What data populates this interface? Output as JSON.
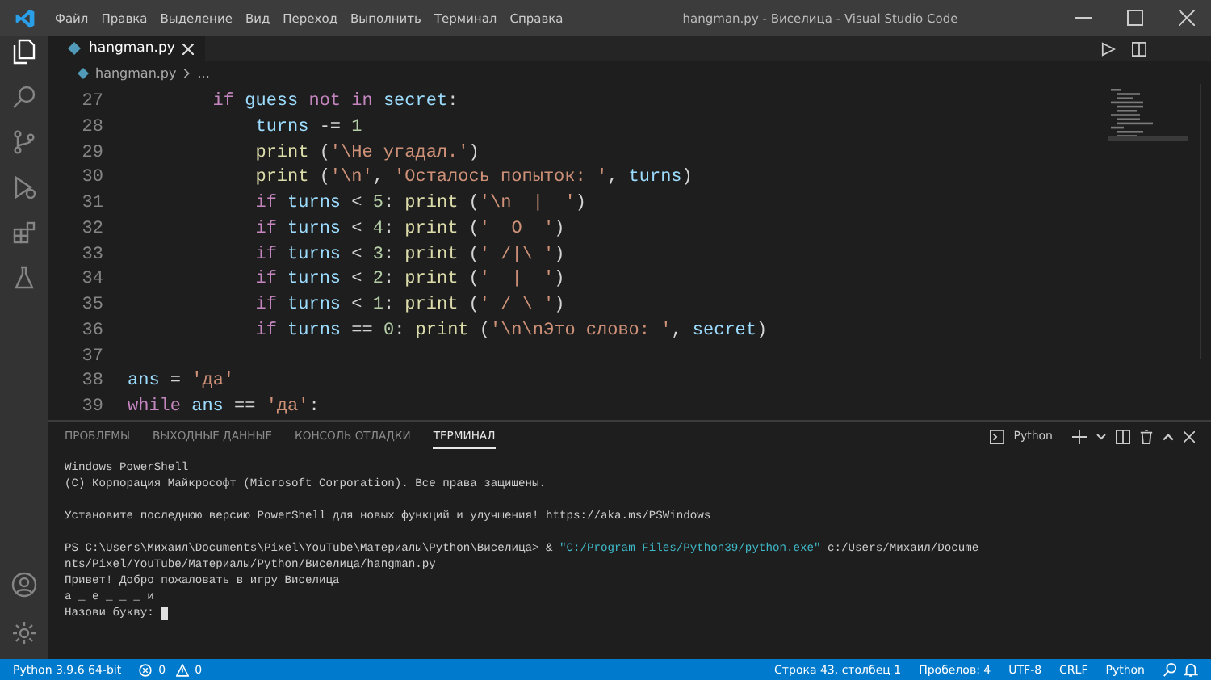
{
  "window": {
    "title": "hangman.py - Виселица - Visual Studio Code"
  },
  "menu": [
    "Файл",
    "Правка",
    "Выделение",
    "Вид",
    "Переход",
    "Выполнить",
    "Терминал",
    "Справка"
  ],
  "activity_bar": [
    {
      "kind": "files",
      "selected": true
    },
    {
      "kind": "search",
      "selected": false
    },
    {
      "kind": "source-control",
      "selected": false
    },
    {
      "kind": "run",
      "selected": false
    },
    {
      "kind": "extensions",
      "selected": false
    },
    {
      "kind": "testing",
      "selected": false
    }
  ],
  "editor_tabs": [
    {
      "label": "hangman.py",
      "selected": true
    }
  ],
  "breadcrumb": [
    "hangman.py",
    "..."
  ],
  "code": [
    {
      "number": "27",
      "tokens": [
        {
          "t": "        if ",
          "color": "#c586c0"
        },
        {
          "t": "guess ",
          "color": "#9cdcfe"
        },
        {
          "t": "not in ",
          "color": "#c586c0"
        },
        {
          "t": "secret",
          "color": "#9cdcfe"
        },
        {
          "t": ":",
          "color": "#d4d4d4"
        }
      ]
    },
    {
      "number": "28",
      "tokens": [
        {
          "t": "            turns",
          "color": "#9cdcfe"
        },
        {
          "t": " -= ",
          "color": "#d4d4d4"
        },
        {
          "t": "1",
          "color": "#b5cea8"
        }
      ]
    },
    {
      "number": "29",
      "tokens": [
        {
          "t": "            print",
          "color": "#dcdcaa"
        },
        {
          "t": " (",
          "color": "#d4d4d4"
        },
        {
          "t": "'\\Не угадал.'",
          "color": "#ce9178"
        },
        {
          "t": ")",
          "color": "#d4d4d4"
        }
      ]
    },
    {
      "number": "30",
      "tokens": [
        {
          "t": "            print",
          "color": "#dcdcaa"
        },
        {
          "t": " (",
          "color": "#d4d4d4"
        },
        {
          "t": "'\\n'",
          "color": "#ce9178"
        },
        {
          "t": ", ",
          "color": "#d4d4d4"
        },
        {
          "t": "'Осталось попыток: '",
          "color": "#ce9178"
        },
        {
          "t": ", ",
          "color": "#d4d4d4"
        },
        {
          "t": "turns",
          "color": "#9cdcfe"
        },
        {
          "t": ")",
          "color": "#d4d4d4"
        }
      ]
    },
    {
      "number": "31",
      "tokens": [
        {
          "t": "            if ",
          "color": "#c586c0"
        },
        {
          "t": "turns",
          "color": "#9cdcfe"
        },
        {
          "t": " < ",
          "color": "#d4d4d4"
        },
        {
          "t": "5",
          "color": "#b5cea8"
        },
        {
          "t": ": ",
          "color": "#d4d4d4"
        },
        {
          "t": "print",
          "color": "#dcdcaa"
        },
        {
          "t": " (",
          "color": "#d4d4d4"
        },
        {
          "t": "'\\n  |  '",
          "color": "#ce9178"
        },
        {
          "t": ")",
          "color": "#d4d4d4"
        }
      ]
    },
    {
      "number": "32",
      "tokens": [
        {
          "t": "            if ",
          "color": "#c586c0"
        },
        {
          "t": "turns",
          "color": "#9cdcfe"
        },
        {
          "t": " < ",
          "color": "#d4d4d4"
        },
        {
          "t": "4",
          "color": "#b5cea8"
        },
        {
          "t": ": ",
          "color": "#d4d4d4"
        },
        {
          "t": "print",
          "color": "#dcdcaa"
        },
        {
          "t": " (",
          "color": "#d4d4d4"
        },
        {
          "t": "'  O  '",
          "color": "#ce9178"
        },
        {
          "t": ")",
          "color": "#d4d4d4"
        }
      ]
    },
    {
      "number": "33",
      "tokens": [
        {
          "t": "            if ",
          "color": "#c586c0"
        },
        {
          "t": "turns",
          "color": "#9cdcfe"
        },
        {
          "t": " < ",
          "color": "#d4d4d4"
        },
        {
          "t": "3",
          "color": "#b5cea8"
        },
        {
          "t": ": ",
          "color": "#d4d4d4"
        },
        {
          "t": "print",
          "color": "#dcdcaa"
        },
        {
          "t": " (",
          "color": "#d4d4d4"
        },
        {
          "t": "' /|\\ '",
          "color": "#ce9178"
        },
        {
          "t": ")",
          "color": "#d4d4d4"
        }
      ]
    },
    {
      "number": "34",
      "tokens": [
        {
          "t": "            if ",
          "color": "#c586c0"
        },
        {
          "t": "turns",
          "color": "#9cdcfe"
        },
        {
          "t": " < ",
          "color": "#d4d4d4"
        },
        {
          "t": "2",
          "color": "#b5cea8"
        },
        {
          "t": ": ",
          "color": "#d4d4d4"
        },
        {
          "t": "print",
          "color": "#dcdcaa"
        },
        {
          "t": " (",
          "color": "#d4d4d4"
        },
        {
          "t": "'  |  '",
          "color": "#ce9178"
        },
        {
          "t": ")",
          "color": "#d4d4d4"
        }
      ]
    },
    {
      "number": "35",
      "tokens": [
        {
          "t": "            if ",
          "color": "#c586c0"
        },
        {
          "t": "turns",
          "color": "#9cdcfe"
        },
        {
          "t": " < ",
          "color": "#d4d4d4"
        },
        {
          "t": "1",
          "color": "#b5cea8"
        },
        {
          "t": ": ",
          "color": "#d4d4d4"
        },
        {
          "t": "print",
          "color": "#dcdcaa"
        },
        {
          "t": " (",
          "color": "#d4d4d4"
        },
        {
          "t": "' / \\ '",
          "color": "#ce9178"
        },
        {
          "t": ")",
          "color": "#d4d4d4"
        }
      ]
    },
    {
      "number": "36",
      "tokens": [
        {
          "t": "            if ",
          "color": "#c586c0"
        },
        {
          "t": "turns",
          "color": "#9cdcfe"
        },
        {
          "t": " == ",
          "color": "#d4d4d4"
        },
        {
          "t": "0",
          "color": "#b5cea8"
        },
        {
          "t": ": ",
          "color": "#d4d4d4"
        },
        {
          "t": "print",
          "color": "#dcdcaa"
        },
        {
          "t": " (",
          "color": "#d4d4d4"
        },
        {
          "t": "'\\n\\nЭто слово: '",
          "color": "#ce9178"
        },
        {
          "t": ", ",
          "color": "#d4d4d4"
        },
        {
          "t": "secret",
          "color": "#9cdcfe"
        },
        {
          "t": ")",
          "color": "#d4d4d4"
        }
      ]
    },
    {
      "number": "37"
    },
    {
      "number": "38",
      "tokens": [
        {
          "t": "ans",
          "color": "#9cdcfe"
        },
        {
          "t": " = ",
          "color": "#d4d4d4"
        },
        {
          "t": "'да'",
          "color": "#ce9178"
        }
      ]
    },
    {
      "number": "39",
      "tokens": [
        {
          "t": "while ",
          "color": "#c586c0"
        },
        {
          "t": "ans",
          "color": "#9cdcfe"
        },
        {
          "t": " == ",
          "color": "#d4d4d4"
        },
        {
          "t": "'да'",
          "color": "#ce9178"
        },
        {
          "t": ":",
          "color": "#d4d4d4"
        }
      ]
    }
  ],
  "panel_tabs": [
    {
      "label": "ПРОБЛЕМЫ",
      "selected": false
    },
    {
      "label": "ВЫХОДНЫЕ ДАННЫЕ",
      "selected": false
    },
    {
      "label": "КОНСОЛЬ ОТЛАДКИ",
      "selected": false
    },
    {
      "label": "ТЕРМИНАЛ",
      "selected": true
    }
  ],
  "terminal_shell": "Python",
  "terminal": {
    "cursor": true,
    "lines": [
      {
        "kind": "text",
        "segments": [
          {
            "t": "Windows PowerShell",
            "color": "#cccccc"
          }
        ]
      },
      {
        "kind": "text",
        "segments": [
          {
            "t": "(C) Корпорация Майкрософт (Microsoft Corporation). Все права защищены.",
            "color": "#cccccc"
          }
        ]
      },
      {
        "kind": "blank"
      },
      {
        "kind": "text",
        "segments": [
          {
            "t": "Установите последнюю версию PowerShell для новых функций и улучшения! https://aka.ms/PSWindows",
            "color": "#cccccc"
          }
        ]
      },
      {
        "kind": "blank"
      },
      {
        "kind": "text",
        "segments": [
          {
            "t": "PS C:\\Users\\Михаил\\Documents\\Pixel\\YouTube\\Материалы\\Python\\Виселица> & ",
            "color": "#cccccc"
          },
          {
            "t": "\"C:/Program Files/Python39/python.exe\"",
            "color": "#3fb8c7"
          },
          {
            "t": " c:/Users/Михаил/Docume",
            "color": "#cccccc"
          }
        ]
      },
      {
        "kind": "text",
        "segments": [
          {
            "t": "nts/Pixel/YouTube/Материалы/Python/Виселица/hangman.py",
            "color": "#cccccc"
          }
        ]
      },
      {
        "kind": "text",
        "segments": [
          {
            "t": "Привет! Добро пожаловать в игру Виселица",
            "color": "#cccccc"
          }
        ]
      },
      {
        "kind": "text",
        "segments": [
          {
            "t": "а _ е _ _ _ и",
            "color": "#cccccc"
          }
        ]
      },
      {
        "kind": "text",
        "segments": [
          {
            "t": "Назови букву: ",
            "color": "#cccccc"
          }
        ]
      }
    ]
  },
  "status_bar": {
    "interpreter": "Python 3.9.6 64-bit",
    "errors": "0",
    "warnings": "0",
    "position": "Строка 43, столбец 1",
    "indent": "Пробелов: 4",
    "encoding": "UTF-8",
    "eol": "CRLF",
    "language": "Python"
  }
}
